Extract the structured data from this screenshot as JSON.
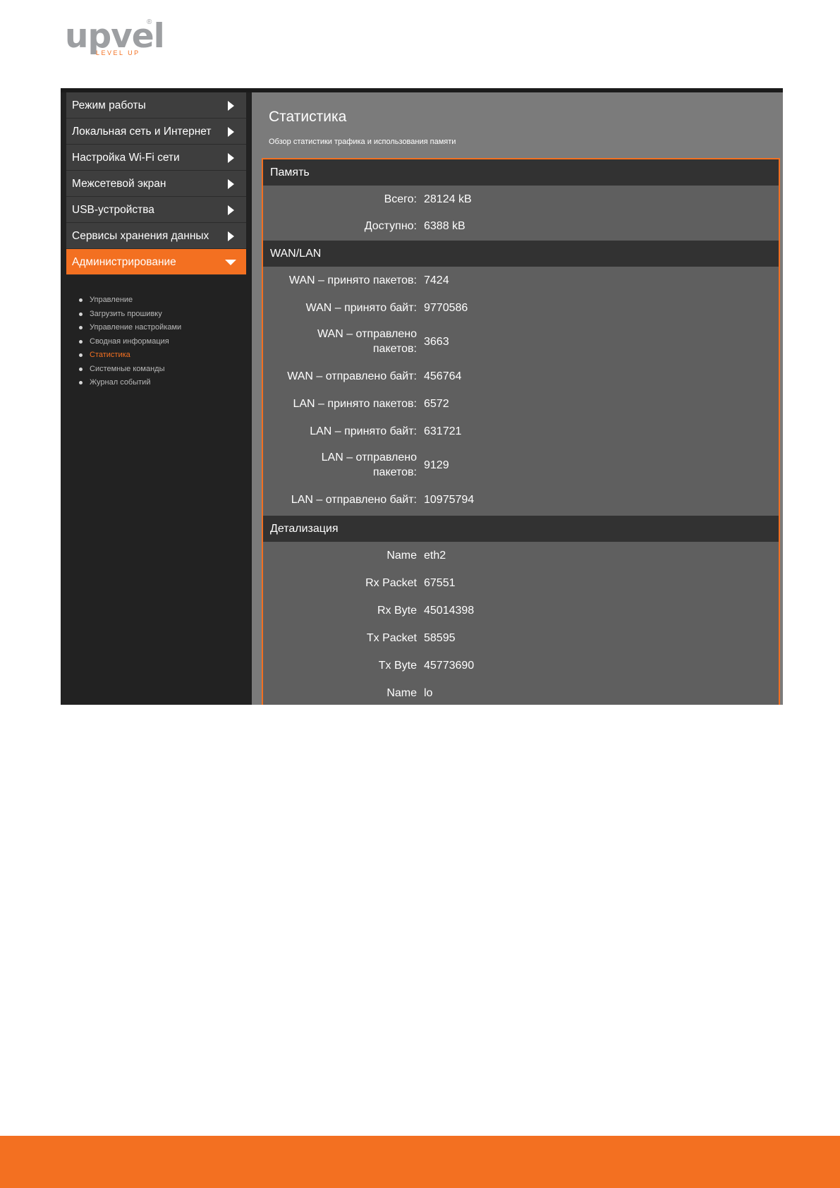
{
  "logo": {
    "word": "upvel",
    "registered": "®",
    "tagline": "LEVEL UP"
  },
  "colors": {
    "accent": "#f37021",
    "sidebar_bg": "#222222",
    "menu_bg": "#3e3e3e",
    "main_bg": "#7b7b7b",
    "table_bg": "#5f5f5f",
    "header_bg": "#323232"
  },
  "sidebar": {
    "items": [
      {
        "label": "Режим работы",
        "icon": "chevron-right-icon"
      },
      {
        "label": "Локальная сеть и Интернет",
        "icon": "chevron-right-icon"
      },
      {
        "label": "Настройка Wi-Fi сети",
        "icon": "chevron-right-icon"
      },
      {
        "label": "Межсетевой экран",
        "icon": "chevron-right-icon"
      },
      {
        "label": "USB-устройства",
        "icon": "chevron-right-icon"
      },
      {
        "label": "Сервисы хранения данных",
        "icon": "chevron-right-icon"
      },
      {
        "label": "Администрирование",
        "icon": "chevron-down-icon",
        "expanded": true
      }
    ],
    "submenu": [
      {
        "label": "Управление"
      },
      {
        "label": "Загрузить прошивку"
      },
      {
        "label": "Управление настройками"
      },
      {
        "label": "Сводная информация"
      },
      {
        "label": "Статистика",
        "active": true
      },
      {
        "label": "Системные команды"
      },
      {
        "label": "Журнал событий"
      }
    ]
  },
  "main": {
    "title": "Статистика",
    "subtitle": "Обзор статистики трафика и использования памяти",
    "sections": {
      "memory": {
        "header": "Память",
        "rows": [
          {
            "label": "Всего:",
            "value": "28124 kB"
          },
          {
            "label": "Доступно:",
            "value": "6388 kB"
          }
        ]
      },
      "wanlan": {
        "header": "WAN/LAN",
        "rows": [
          {
            "label": "WAN – принято пакетов:",
            "value": "7424"
          },
          {
            "label": "WAN – принято байт:",
            "value": "9770586"
          },
          {
            "label": "WAN – отправлено пакетов:",
            "value": "3663"
          },
          {
            "label": "WAN – отправлено байт:",
            "value": "456764"
          },
          {
            "label": "LAN – принято пакетов:",
            "value": "6572"
          },
          {
            "label": "LAN – принято байт:",
            "value": "631721"
          },
          {
            "label": "LAN – отправлено пакетов:",
            "value": "9129"
          },
          {
            "label": "LAN – отправлено байт:",
            "value": "10975794"
          }
        ]
      },
      "details": {
        "header": "Детализация",
        "rows": [
          {
            "label": "Name",
            "value": "eth2"
          },
          {
            "label": "Rx Packet",
            "value": "67551"
          },
          {
            "label": "Rx Byte",
            "value": "45014398"
          },
          {
            "label": "Tx Packet",
            "value": "58595"
          },
          {
            "label": "Tx Byte",
            "value": "45773690"
          },
          {
            "label": "Name",
            "value": "lo"
          }
        ]
      }
    }
  }
}
